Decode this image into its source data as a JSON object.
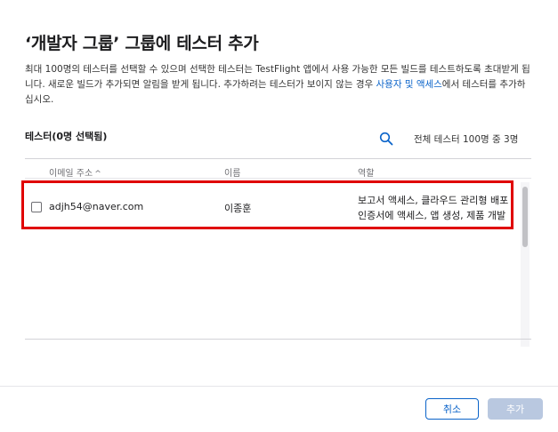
{
  "dialog": {
    "title": "‘개발자 그룹’ 그룹에 테스터 추가",
    "description_part1": "최대 100명의 테스터를 선택할 수 있으며 선택한 테스터는 TestFlight 앱에서 사용 가능한 모든 빌드를 테스트하도록 초대받게 됩니다. 새로운 빌드가 추가되면 알림을 받게 됩니다. 추가하려는 테스터가 보이지 않는 경우 ",
    "description_link": "사용자 및 액세스",
    "description_part2": "에서 테스터를 추가하십시오."
  },
  "tester_list": {
    "selected_label": "테스터(0명 선택됨)",
    "search_icon": "search-icon",
    "total_label": "전체 테스터 100명 중 3명",
    "columns": [
      "이메일 주소",
      "이름",
      "역할"
    ],
    "sort_indicator": "^",
    "rows": [
      {
        "email": "adjh54@naver.com",
        "name": "이종훈",
        "role_line1": "보고서 액세스, 클라우드 관리형 배포",
        "role_line2": "인증서에 액세스, 앱 생성, 제품 개발",
        "checked": false
      }
    ]
  },
  "buttons": {
    "cancel": "취소",
    "add": "추가"
  },
  "colors": {
    "accent": "#0a63c9",
    "highlight": "#e00000",
    "disabled_button": "#b9c8e0"
  }
}
